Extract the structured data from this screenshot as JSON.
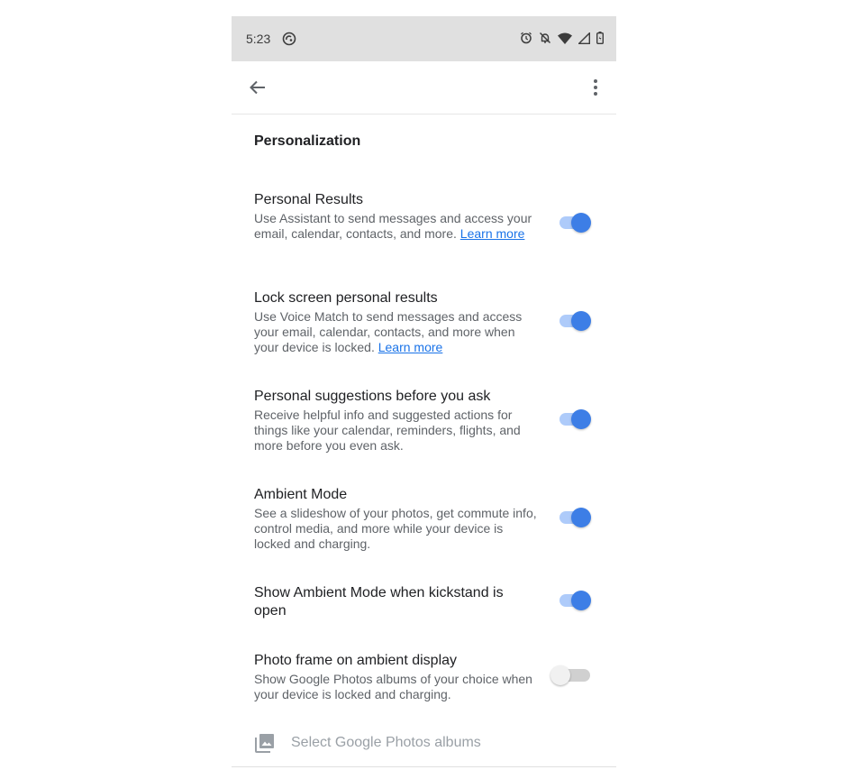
{
  "status_bar": {
    "time": "5:23",
    "left_icon": "sync-circle-icon",
    "right_icons": [
      "alarm-icon",
      "notifications-off-icon",
      "wifi-icon",
      "signal-icon",
      "battery-icon"
    ]
  },
  "app_bar": {
    "back_icon": "arrow-back-icon",
    "more_icon": "more-vert-icon"
  },
  "section": {
    "title": "Personalization"
  },
  "settings": [
    {
      "title": "Personal Results",
      "description": "Use Assistant to send messages and access your email, calendar, contacts, and more.",
      "link": "Learn more",
      "enabled": true
    },
    {
      "title": "Lock screen personal results",
      "description": "Use Voice Match to send messages and access your email, calendar, contacts, and more when your device is locked.",
      "link": "Learn more",
      "enabled": true
    },
    {
      "title": "Personal suggestions before you ask",
      "description": "Receive helpful info and suggested actions for things like your calendar, reminders, flights, and more before you even ask.",
      "enabled": true
    },
    {
      "title": "Ambient Mode",
      "description": "See a slideshow of your photos, get commute info, control media, and more while your device is locked and charging.",
      "enabled": true
    },
    {
      "title": "Show Ambient Mode when kickstand is open",
      "enabled": true
    },
    {
      "title": "Photo frame on ambient display",
      "description": "Show Google Photos albums of your choice when your device is locked and charging.",
      "enabled": false
    }
  ],
  "albums": {
    "icon": "photo-library-icon",
    "label": "Select Google Photos albums"
  },
  "colors": {
    "accent": "#3d7ee6",
    "accent_track": "#aecbfa",
    "link": "#1a73e8",
    "status_bar_bg": "#e0e0e0"
  }
}
